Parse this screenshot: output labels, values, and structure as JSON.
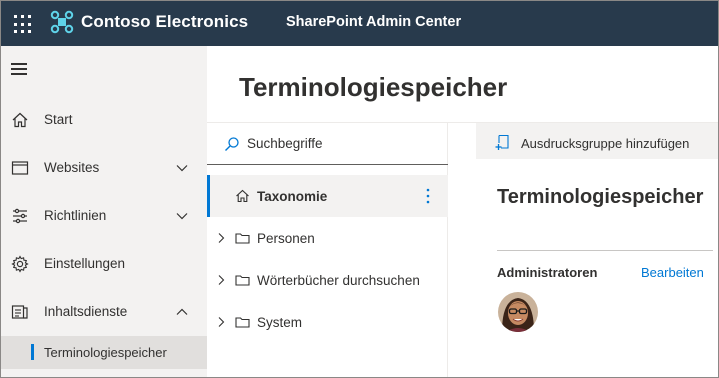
{
  "topbar": {
    "brand": "Contoso Electronics",
    "app_title": "SharePoint Admin Center",
    "background_color": "#283a4c",
    "waffle_icon": "app-launcher-icon",
    "brand_icon": "contoso-logo-icon"
  },
  "leftnav": {
    "items": [
      {
        "label": "Start",
        "icon": "home-icon"
      },
      {
        "label": "Websites",
        "icon": "websites-icon",
        "chevron": "chevron-down-icon"
      },
      {
        "label": "Richtlinien",
        "icon": "policies-icon",
        "chevron": "chevron-down-icon"
      },
      {
        "label": "Einstellungen",
        "icon": "settings-icon"
      },
      {
        "label": "Inhaltsdienste",
        "icon": "content-services-icon",
        "chevron": "chevron-up-icon"
      }
    ],
    "sub_item": {
      "label": "Terminologiespeicher",
      "selected": true
    }
  },
  "main": {
    "title": "Terminologiespeicher"
  },
  "tree": {
    "search_placeholder": "Suchbegriffe",
    "items": [
      {
        "label": "Taxonomie",
        "icon": "home-icon",
        "selected": true
      },
      {
        "label": "Personen",
        "icon": "folder-icon"
      },
      {
        "label": "Wörterbücher durchsuchen",
        "icon": "folder-icon"
      },
      {
        "label": "System",
        "icon": "folder-icon"
      }
    ]
  },
  "detail": {
    "command_label": "Ausdrucksgruppe hinzufügen",
    "title": "Terminologiespeicher",
    "admins_label": "Administratoren",
    "edit_label": "Bearbeiten"
  },
  "colors": {
    "accent": "#0078d4",
    "nav_background": "#f3f2f1",
    "selected_background": "#e1dfdd"
  }
}
